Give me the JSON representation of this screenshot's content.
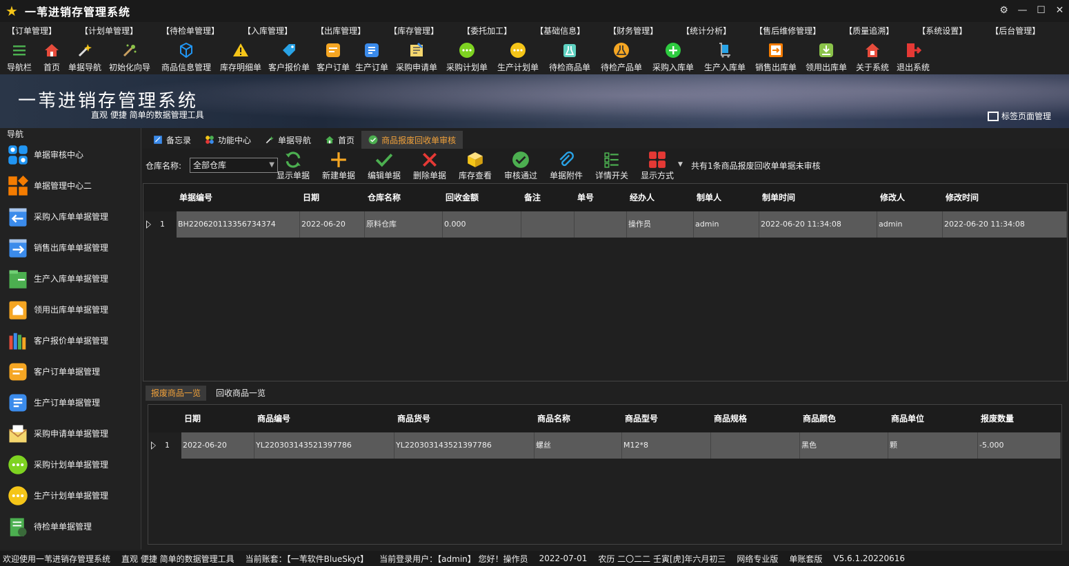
{
  "app": {
    "title": "一苇进销存管理系统"
  },
  "menu": [
    "【订单管理】",
    "【计划单管理】",
    "【待检单管理】",
    "【入库管理】",
    "【出库管理】",
    "【库存管理】",
    "【委托加工】",
    "【基础信息】",
    "【财务管理】",
    "【统计分析】",
    "【售后维修管理】",
    "【质量追溯】",
    "【系统设置】",
    "【后台管理】"
  ],
  "toolbar": [
    {
      "label": "导航栏",
      "icon": "menu-icon",
      "color": "#4caf50"
    },
    {
      "label": "首页",
      "icon": "home-icon",
      "color": "#e74c3c"
    },
    {
      "label": "单据导航",
      "icon": "wand-icon",
      "color": "#f5c518"
    },
    {
      "label": "初始化向导",
      "icon": "magic-wand-icon",
      "color": "#8bc34a"
    },
    {
      "label": "商品信息管理",
      "icon": "cubes-icon",
      "color": "#2196f3"
    },
    {
      "label": "库存明细单",
      "icon": "warning-icon",
      "color": "#f5c518"
    },
    {
      "label": "客户报价单",
      "icon": "tag-icon",
      "color": "#29a3e6"
    },
    {
      "label": "客户订单",
      "icon": "order-icon",
      "color": "#f5a623"
    },
    {
      "label": "生产订单",
      "icon": "doc-icon",
      "color": "#3b8beb"
    },
    {
      "label": "采购申请单",
      "icon": "request-icon",
      "color": "#f5d76e"
    },
    {
      "label": "采购计划单",
      "icon": "chat-icon",
      "color": "#7ed321"
    },
    {
      "label": "生产计划单",
      "icon": "chat-icon",
      "color": "#f5c518"
    },
    {
      "label": "待检商品单",
      "icon": "flask-icon",
      "color": "#5ed1c1"
    },
    {
      "label": "待检产品单",
      "icon": "beaker-icon",
      "color": "#f5a623"
    },
    {
      "label": "采购入库单",
      "icon": "plus-circle-icon",
      "color": "#2ecc40"
    },
    {
      "label": "生产入库单",
      "icon": "trolley-icon",
      "color": "#29a3e6"
    },
    {
      "label": "销售出库单",
      "icon": "export-icon",
      "color": "#f57c00"
    },
    {
      "label": "领用出库单",
      "icon": "download-icon",
      "color": "#8bc34a"
    },
    {
      "label": "关于系统",
      "icon": "about-icon",
      "color": "#e74c3c"
    },
    {
      "label": "退出系统",
      "icon": "exit-icon",
      "color": "#e53935"
    }
  ],
  "banner": {
    "title": "一苇进销存管理系统",
    "subtitle": "直观 便捷 简单的数据管理工具",
    "tab_manage": "标签页面管理"
  },
  "nav": {
    "header": "导航",
    "items": [
      {
        "label": "单据审核中心",
        "icon": "grid-icon",
        "color": "#2196f3"
      },
      {
        "label": "单据管理中心二",
        "icon": "grid-diamond-icon",
        "color": "#f57c00"
      },
      {
        "label": "采购入库单单据管理",
        "icon": "arrow-left-doc-icon",
        "color": "#3b8beb"
      },
      {
        "label": "销售出库单单据管理",
        "icon": "arrow-right-doc-icon",
        "color": "#3b8beb"
      },
      {
        "label": "生产入库单单据管理",
        "icon": "box-green-icon",
        "color": "#4caf50"
      },
      {
        "label": "领用出库单单据管理",
        "icon": "house-doc-icon",
        "color": "#f5a623"
      },
      {
        "label": "客户报价单单据管理",
        "icon": "books-icon",
        "color": "#e74c3c"
      },
      {
        "label": "客户订单单据管理",
        "icon": "order-icon",
        "color": "#f5a623"
      },
      {
        "label": "生产订单单据管理",
        "icon": "doc-icon",
        "color": "#3b8beb"
      },
      {
        "label": "采购申请单单据管理",
        "icon": "envelope-icon",
        "color": "#f5d76e"
      },
      {
        "label": "采购计划单单据管理",
        "icon": "chat-icon",
        "color": "#7ed321"
      },
      {
        "label": "生产计划单单据管理",
        "icon": "chat-icon",
        "color": "#f5c518"
      },
      {
        "label": "待检单单据管理",
        "icon": "inspect-doc-icon",
        "color": "#4caf50"
      }
    ]
  },
  "tabs": [
    {
      "label": "备忘录",
      "icon": "memo-icon",
      "active": false
    },
    {
      "label": "功能中心",
      "icon": "function-icon",
      "active": false
    },
    {
      "label": "单据导航",
      "icon": "wand-icon",
      "active": false
    },
    {
      "label": "首页",
      "icon": "home-icon",
      "active": false
    },
    {
      "label": "商品报废回收单审核",
      "icon": "check-icon",
      "active": true
    }
  ],
  "content_toolbar": {
    "warehouse_label": "仓库名称:",
    "warehouse_value": "全部仓库",
    "buttons": [
      {
        "label": "显示单据",
        "icon": "refresh-icon",
        "color": "#4caf50"
      },
      {
        "label": "新建单据",
        "icon": "plus-icon",
        "color": "#f5a623"
      },
      {
        "label": "编辑单据",
        "icon": "check-icon",
        "color": "#4caf50"
      },
      {
        "label": "删除单据",
        "icon": "x-icon",
        "color": "#e53935"
      },
      {
        "label": "库存查看",
        "icon": "box-icon",
        "color": "#f5c518"
      },
      {
        "label": "审核通过",
        "icon": "check-circle-icon",
        "color": "#4caf50"
      },
      {
        "label": "单据附件",
        "icon": "paperclip-icon",
        "color": "#29a3e6"
      },
      {
        "label": "详情开关",
        "icon": "list-check-icon",
        "color": "#4caf50"
      },
      {
        "label": "显示方式",
        "icon": "tiles-icon",
        "color": "#e53935"
      }
    ],
    "message": "共有1条商品报废回收单单据未审核"
  },
  "main_table": {
    "columns": [
      "单据编号",
      "日期",
      "仓库名称",
      "回收金额",
      "备注",
      "单号",
      "经办人",
      "制单人",
      "制单时间",
      "修改人",
      "修改时间"
    ],
    "rows": [
      {
        "rownum": "1",
        "cells": [
          "BH220620113356734374",
          "2022-06-20",
          "原料仓库",
          "0.000",
          "",
          "",
          "操作员",
          "admin",
          "2022-06-20 11:34:08",
          "admin",
          "2022-06-20 11:34:08"
        ]
      }
    ]
  },
  "sub_tabs": [
    {
      "label": "报废商品一览",
      "active": true
    },
    {
      "label": "回收商品一览",
      "active": false
    }
  ],
  "detail_table": {
    "columns": [
      "日期",
      "商品编号",
      "商品货号",
      "商品名称",
      "商品型号",
      "商品规格",
      "商品颜色",
      "商品单位",
      "报废数量"
    ],
    "rows": [
      {
        "rownum": "1",
        "cells": [
          "2022-06-20",
          "YL220303143521397786",
          "YL220303143521397786",
          "螺丝",
          "M12*8",
          "",
          "黑色",
          "颗",
          "-5.000"
        ]
      }
    ]
  },
  "status": [
    "欢迎使用一苇进销存管理系统",
    "直观 便捷 简单的数据管理工具",
    "当前账套：【一苇软件BlueSkyt】",
    "当前登录用户：【admin】 您好！操作员",
    "2022-07-01",
    "农历 二〇二二 壬寅[虎]年六月初三",
    "网络专业版",
    "单账套版",
    "V5.6.1.20220616"
  ]
}
